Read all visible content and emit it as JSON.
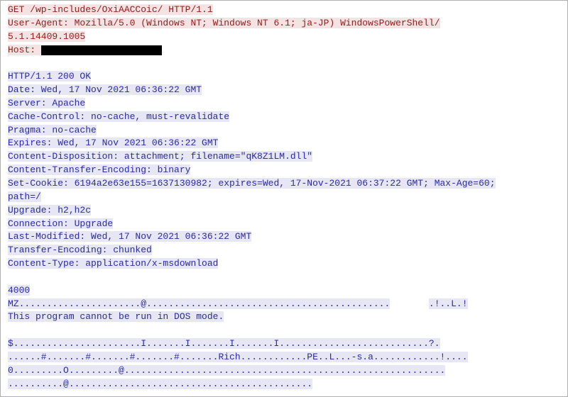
{
  "request": {
    "line0": "GET /wp-includes/OxiAACCoic/ HTTP/1.1",
    "line1": "User-Agent: Mozilla/5.0 (Windows NT; Windows NT 6.1; ja-JP) WindowsPowerShell/",
    "line2": "5.1.14409.1005",
    "host_label": "Host: "
  },
  "response": {
    "status": "HTTP/1.1 200 OK",
    "date": "Date: Wed, 17 Nov 2021 06:36:22 GMT",
    "server": "Server: Apache",
    "cache_control": "Cache-Control: no-cache, must-revalidate",
    "pragma": "Pragma: no-cache",
    "expires": "Expires: Wed, 17 Nov 2021 06:36:22 GMT",
    "content_disposition": "Content-Disposition: attachment; filename=\"qK8Z1LM.dll\"",
    "cte": "Content-Transfer-Encoding: binary",
    "set_cookie": "Set-Cookie: 6194a2e63e155=1637130982; expires=Wed, 17-Nov-2021 06:37:22 GMT; Max-Age=60;",
    "set_cookie2": "path=/",
    "upgrade": "Upgrade: h2,h2c",
    "connection": "Connection: Upgrade",
    "last_modified": "Last-Modified: Wed, 17 Nov 2021 06:36:22 GMT",
    "transfer_encoding": "Transfer-Encoding: chunked",
    "content_type": "Content-Type: application/x-msdownload"
  },
  "body": {
    "chunk": "4000",
    "mz1a": "MZ......................@............................................",
    "mz1b": ".!..L.!",
    "dos": "This program cannot be run in DOS mode.",
    "hex1a": "$.......................I.......I.......I.......I...........................",
    "hex1b": "?.",
    "hex2": "......#.......#.......#.......#.......Rich............PE..L...-s.a............!....",
    "hex3": "0.........O.........@..........................................................",
    "hex4": "..........@............................................"
  }
}
